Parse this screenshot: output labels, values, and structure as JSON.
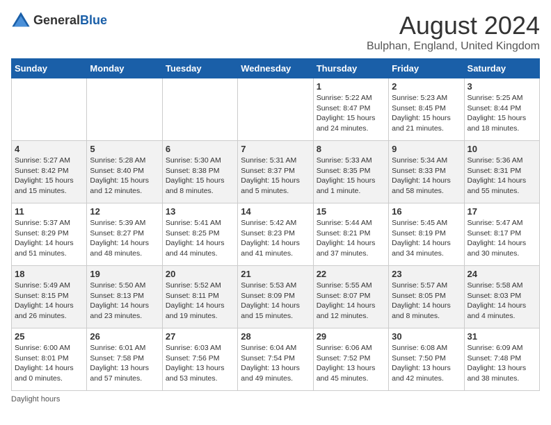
{
  "logo": {
    "text1": "General",
    "text2": "Blue"
  },
  "title": "August 2024",
  "subtitle": "Bulphan, England, United Kingdom",
  "days_of_week": [
    "Sunday",
    "Monday",
    "Tuesday",
    "Wednesday",
    "Thursday",
    "Friday",
    "Saturday"
  ],
  "footer": {
    "daylight_label": "Daylight hours"
  },
  "weeks": [
    [
      {
        "day": "",
        "info": ""
      },
      {
        "day": "",
        "info": ""
      },
      {
        "day": "",
        "info": ""
      },
      {
        "day": "",
        "info": ""
      },
      {
        "day": "1",
        "info": "Sunrise: 5:22 AM\nSunset: 8:47 PM\nDaylight: 15 hours\nand 24 minutes."
      },
      {
        "day": "2",
        "info": "Sunrise: 5:23 AM\nSunset: 8:45 PM\nDaylight: 15 hours\nand 21 minutes."
      },
      {
        "day": "3",
        "info": "Sunrise: 5:25 AM\nSunset: 8:44 PM\nDaylight: 15 hours\nand 18 minutes."
      }
    ],
    [
      {
        "day": "4",
        "info": "Sunrise: 5:27 AM\nSunset: 8:42 PM\nDaylight: 15 hours\nand 15 minutes."
      },
      {
        "day": "5",
        "info": "Sunrise: 5:28 AM\nSunset: 8:40 PM\nDaylight: 15 hours\nand 12 minutes."
      },
      {
        "day": "6",
        "info": "Sunrise: 5:30 AM\nSunset: 8:38 PM\nDaylight: 15 hours\nand 8 minutes."
      },
      {
        "day": "7",
        "info": "Sunrise: 5:31 AM\nSunset: 8:37 PM\nDaylight: 15 hours\nand 5 minutes."
      },
      {
        "day": "8",
        "info": "Sunrise: 5:33 AM\nSunset: 8:35 PM\nDaylight: 15 hours\nand 1 minute."
      },
      {
        "day": "9",
        "info": "Sunrise: 5:34 AM\nSunset: 8:33 PM\nDaylight: 14 hours\nand 58 minutes."
      },
      {
        "day": "10",
        "info": "Sunrise: 5:36 AM\nSunset: 8:31 PM\nDaylight: 14 hours\nand 55 minutes."
      }
    ],
    [
      {
        "day": "11",
        "info": "Sunrise: 5:37 AM\nSunset: 8:29 PM\nDaylight: 14 hours\nand 51 minutes."
      },
      {
        "day": "12",
        "info": "Sunrise: 5:39 AM\nSunset: 8:27 PM\nDaylight: 14 hours\nand 48 minutes."
      },
      {
        "day": "13",
        "info": "Sunrise: 5:41 AM\nSunset: 8:25 PM\nDaylight: 14 hours\nand 44 minutes."
      },
      {
        "day": "14",
        "info": "Sunrise: 5:42 AM\nSunset: 8:23 PM\nDaylight: 14 hours\nand 41 minutes."
      },
      {
        "day": "15",
        "info": "Sunrise: 5:44 AM\nSunset: 8:21 PM\nDaylight: 14 hours\nand 37 minutes."
      },
      {
        "day": "16",
        "info": "Sunrise: 5:45 AM\nSunset: 8:19 PM\nDaylight: 14 hours\nand 34 minutes."
      },
      {
        "day": "17",
        "info": "Sunrise: 5:47 AM\nSunset: 8:17 PM\nDaylight: 14 hours\nand 30 minutes."
      }
    ],
    [
      {
        "day": "18",
        "info": "Sunrise: 5:49 AM\nSunset: 8:15 PM\nDaylight: 14 hours\nand 26 minutes."
      },
      {
        "day": "19",
        "info": "Sunrise: 5:50 AM\nSunset: 8:13 PM\nDaylight: 14 hours\nand 23 minutes."
      },
      {
        "day": "20",
        "info": "Sunrise: 5:52 AM\nSunset: 8:11 PM\nDaylight: 14 hours\nand 19 minutes."
      },
      {
        "day": "21",
        "info": "Sunrise: 5:53 AM\nSunset: 8:09 PM\nDaylight: 14 hours\nand 15 minutes."
      },
      {
        "day": "22",
        "info": "Sunrise: 5:55 AM\nSunset: 8:07 PM\nDaylight: 14 hours\nand 12 minutes."
      },
      {
        "day": "23",
        "info": "Sunrise: 5:57 AM\nSunset: 8:05 PM\nDaylight: 14 hours\nand 8 minutes."
      },
      {
        "day": "24",
        "info": "Sunrise: 5:58 AM\nSunset: 8:03 PM\nDaylight: 14 hours\nand 4 minutes."
      }
    ],
    [
      {
        "day": "25",
        "info": "Sunrise: 6:00 AM\nSunset: 8:01 PM\nDaylight: 14 hours\nand 0 minutes."
      },
      {
        "day": "26",
        "info": "Sunrise: 6:01 AM\nSunset: 7:58 PM\nDaylight: 13 hours\nand 57 minutes."
      },
      {
        "day": "27",
        "info": "Sunrise: 6:03 AM\nSunset: 7:56 PM\nDaylight: 13 hours\nand 53 minutes."
      },
      {
        "day": "28",
        "info": "Sunrise: 6:04 AM\nSunset: 7:54 PM\nDaylight: 13 hours\nand 49 minutes."
      },
      {
        "day": "29",
        "info": "Sunrise: 6:06 AM\nSunset: 7:52 PM\nDaylight: 13 hours\nand 45 minutes."
      },
      {
        "day": "30",
        "info": "Sunrise: 6:08 AM\nSunset: 7:50 PM\nDaylight: 13 hours\nand 42 minutes."
      },
      {
        "day": "31",
        "info": "Sunrise: 6:09 AM\nSunset: 7:48 PM\nDaylight: 13 hours\nand 38 minutes."
      }
    ]
  ]
}
